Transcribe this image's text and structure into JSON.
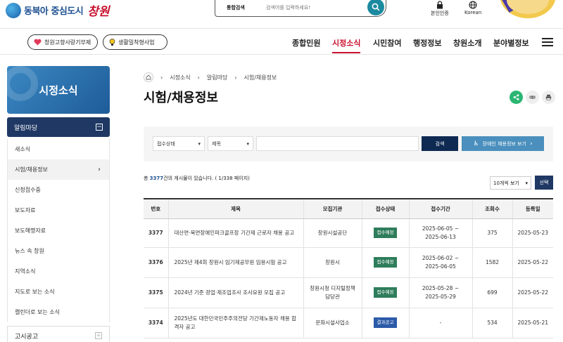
{
  "header": {
    "logo_text": "동북아 중심도시",
    "logo_script": "창원",
    "search_category": "통합검색",
    "search_placeholder": "검색어를 입력하세요!",
    "auth_label": "본인인증",
    "lang_label": "Korean"
  },
  "nav": {
    "pill1": "창원고향사랑기부제",
    "pill2": "생활밀착형사업",
    "menus": [
      "종합민원",
      "시정소식",
      "시민참여",
      "행정정보",
      "창원소개",
      "분야별정보"
    ],
    "active_index": 1
  },
  "sidebar": {
    "title": "시정소식",
    "group": "알림마당",
    "items": [
      "새소식",
      "시험/채용정보",
      "신청접수중",
      "보도자료",
      "보도해명자료",
      "뉴스 속 창원",
      "지역소식",
      "지도로 보는 소식",
      "캘린더로 보는 소식"
    ],
    "active_index": 1,
    "group2": "고시공고"
  },
  "breadcrumb": [
    "시정소식",
    "알림마당",
    "시험/채용정보"
  ],
  "page_title": "시험/채용정보",
  "filter": {
    "status_select": "접수상태",
    "field_select": "제목",
    "search_btn": "검색",
    "disabled_btn": "장애인 채용정보 보기"
  },
  "count": {
    "prefix": "총 ",
    "total": "3377",
    "suffix": "건의 게시물이 있습니다. ( 1/338 페이지)",
    "per_page": "10개씩 보기",
    "select_btn": "선택"
  },
  "table": {
    "headers": [
      "번호",
      "제목",
      "모집기관",
      "접수상태",
      "접수기간",
      "조회수",
      "등록일"
    ],
    "rows": [
      {
        "no": "3377",
        "title": "대산면·북면장애인파크골프장 기간제 근로자 채용 공고",
        "org": "창원시설공단",
        "status": "접수예정",
        "period1": "2025-06-05 ~",
        "period2": "2025-06-13",
        "views": "375",
        "date": "2025-05-23"
      },
      {
        "no": "3376",
        "title": "2025년 제4회 창원시 임기제공무원 임용시험 공고",
        "org": "창원시",
        "status": "접수예정",
        "period1": "2025-06-02 ~",
        "period2": "2025-06-05",
        "views": "1582",
        "date": "2025-05-22"
      },
      {
        "no": "3375",
        "title": "2024년 기준 광업·제조업조사 조사요원 모집 공고",
        "org1": "창원시청 디지털정책",
        "org2": "담당관",
        "status": "접수예정",
        "period1": "2025-05-28 ~",
        "period2": "2025-05-29",
        "views": "699",
        "date": "2025-05-22"
      },
      {
        "no": "3374",
        "title1": "2025년도 대한민국민주주의전당 기간제노동자 채용 합",
        "title2": "격자 공고",
        "org": "문화시설사업소",
        "status": "결과공고",
        "period": "-",
        "views": "534",
        "date": "2025-05-21"
      }
    ]
  }
}
